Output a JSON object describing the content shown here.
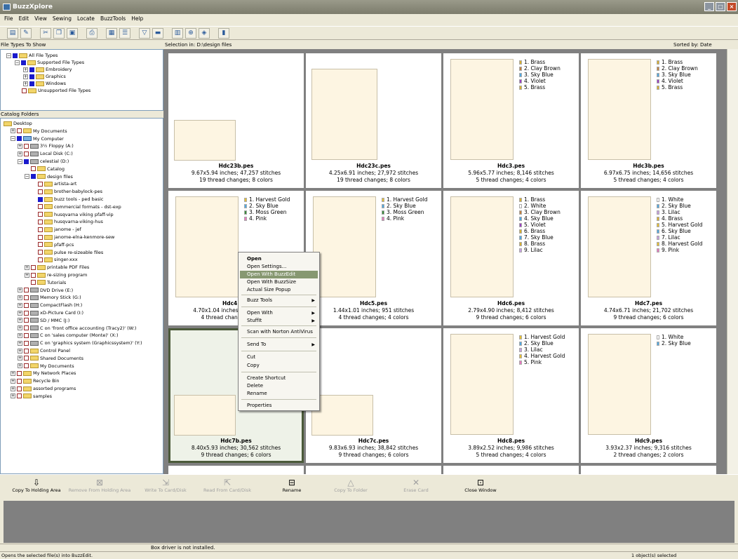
{
  "app": {
    "title": "BuzzXplore"
  },
  "menu": [
    "File",
    "Edit",
    "View",
    "Sewing",
    "Locate",
    "BuzzTools",
    "Help"
  ],
  "panels": {
    "file_types_label": "File Types To Show",
    "catalog_folders_label": "Catalog Folders",
    "selection_in": "Selection in: D:\\design files",
    "sorted_by": "Sorted by: Date"
  },
  "file_types": [
    "All File Types",
    "Supported File Types",
    "Embroidery",
    "Graphics",
    "Windows",
    "Unsupported File Types"
  ],
  "folders": [
    "Desktop",
    "My Documents",
    "My Computer",
    "3½ Floppy (A:)",
    "Local Disk (C:)",
    "celestial (D:)",
    "Catalog",
    "design files",
    "artista-art",
    "brother-babylock-pes",
    "buzz tools - ped basic",
    "commercial formats - dst-exp",
    "husqvarna viking pfaff-vip",
    "husqvarna-viking-hus",
    "janome - jef",
    "janome-elna-kenmore-sew",
    "pfaff-pcs",
    "pulse re-sizeable files",
    "singer-xxx",
    "printable PDF Files",
    "re-sizing program",
    "Tutorials",
    "DVD Drive (E:)",
    "Memory Stick (G:)",
    "CompactFlash (H:)",
    "xD-Picture Card (I:)",
    "SD / MMC (J:)",
    "C on 'front office accounting (Tracy2)' (W:)",
    "C on 'sales computer (Monte)' (X:)",
    "C on 'graphics system (Graphicssystem)' (Y:)",
    "Control Panel",
    "Shared Documents",
    "My Documents",
    "My Network Places",
    "Recycle Bin",
    "assorted programs",
    "samples"
  ],
  "cards": [
    {
      "name": "Hdc23b.pes",
      "dims": "9.67x5.94 inches; 47,257 stitches",
      "tc": "19 thread changes; 8 colors",
      "legend": []
    },
    {
      "name": "Hdc23c.pes",
      "dims": "4.25x6.91 inches; 27,972 stitches",
      "tc": "19 thread changes; 8 colors",
      "legend": []
    },
    {
      "name": "Hdc3.pes",
      "dims": "5.96x5.77 inches; 8,146 stitches",
      "tc": "5 thread changes; 4 colors",
      "legend": [
        "1.  Brass",
        "2.  Clay Brown",
        "3.  Sky Blue",
        "4.  Violet",
        "5.  Brass"
      ],
      "colors": [
        "#d8b030",
        "#c08040",
        "#50a8e0",
        "#9a40c0",
        "#d8b030"
      ]
    },
    {
      "name": "Hdc3b.pes",
      "dims": "6.97x6.75 inches; 14,656 stitches",
      "tc": "5 thread changes; 4 colors",
      "legend": [
        "1.  Brass",
        "2.  Clay Brown",
        "3.  Sky Blue",
        "4.  Violet",
        "5.  Brass"
      ],
      "colors": [
        "#d8b030",
        "#c08040",
        "#50a8e0",
        "#9a40c0",
        "#d8b030"
      ]
    },
    {
      "name": "Hdc4.pes",
      "dims": "4.70x1.04 inches; 8,071 stitches",
      "tc": "4 thread changes; 4 colors",
      "legend": [
        "1.  Harvest Gold",
        "2.  Sky Blue",
        "3.  Moss Green",
        "4.  Pink"
      ],
      "colors": [
        "#e8c030",
        "#50a8e0",
        "#3a8a3a",
        "#e878c0"
      ]
    },
    {
      "name": "Hdc5.pes",
      "dims": "1.44x1.01 inches; 951 stitches",
      "tc": "4 thread changes; 4 colors",
      "legend": [
        "1.  Harvest Gold",
        "2.  Sky Blue",
        "3.  Moss Green",
        "4.  Pink"
      ],
      "colors": [
        "#e8c030",
        "#50a8e0",
        "#3a8a3a",
        "#e878c0"
      ]
    },
    {
      "name": "Hdc6.pes",
      "dims": "2.79x4.90 inches; 8,412 stitches",
      "tc": "9 thread changes; 6 colors",
      "legend": [
        "1.  Brass",
        "2.  White",
        "3.  Clay Brown",
        "4.  Sky Blue",
        "5.  Violet",
        "6.  Brass",
        "7.  Sky Blue",
        "8.  Brass",
        "9.  Lilac"
      ],
      "colors": [
        "#d8b030",
        "#ffffff",
        "#c08040",
        "#50a8e0",
        "#9a40c0",
        "#d8b030",
        "#50a8e0",
        "#d8b030",
        "#c8a0e0"
      ]
    },
    {
      "name": "Hdc7.pes",
      "dims": "4.74x6.71 inches; 21,702 stitches",
      "tc": "9 thread changes; 6 colors",
      "legend": [
        "1.  White",
        "2.  Sky Blue",
        "3.  Lilac",
        "4.  Brass",
        "5.  Harvest Gold",
        "6.  Sky Blue",
        "7.  Lilac",
        "8.  Harvest Gold",
        "9.  Pink"
      ],
      "colors": [
        "#ffffff",
        "#50a8e0",
        "#c8a0e0",
        "#d8b030",
        "#e8c030",
        "#50a8e0",
        "#c8a0e0",
        "#e8c030",
        "#e878c0"
      ]
    },
    {
      "name": "Hdc7b.pes",
      "dims": "8.40x5.93 inches; 30,562 stitches",
      "tc": "9 thread changes; 6 colors",
      "legend": []
    },
    {
      "name": "Hdc7c.pes",
      "dims": "9.83x6.93 inches; 38,842 stitches",
      "tc": "9 thread changes; 6 colors",
      "legend": []
    },
    {
      "name": "Hdc8.pes",
      "dims": "3.89x2.52 inches; 9,986 stitches",
      "tc": "5 thread changes; 4 colors",
      "legend": [
        "1.  Harvest Gold",
        "2.  Sky Blue",
        "3.  Lilac",
        "4.  Harvest Gold",
        "5.  Pink"
      ],
      "colors": [
        "#e8c030",
        "#50a8e0",
        "#c8a0e0",
        "#e8c030",
        "#e878c0"
      ]
    },
    {
      "name": "Hdc9.pes",
      "dims": "3.93x2.37 inches; 9,316 stitches",
      "tc": "2 thread changes; 2 colors",
      "legend": [
        "1.  White",
        "2.  Sky Blue"
      ],
      "colors": [
        "#ffffff",
        "#50a8e0"
      ]
    }
  ],
  "context_menu": [
    "Open",
    "Open Settings...",
    "Open With BuzzEdit",
    "Open With BuzzSize",
    "Actual Size Popup",
    "Buzz Tools",
    "Open With",
    "StuffIt",
    "Scan with Norton AntiVirus",
    "Send To",
    "Cut",
    "Copy",
    "Create Shortcut",
    "Delete",
    "Rename",
    "Properties"
  ],
  "bottom_buttons": [
    "Copy To Holding Area",
    "Remove From Holding Area",
    "Write To Card/Disk",
    "Read From Card/Disk",
    "Rename",
    "Copy To Folder",
    "Erase Card",
    "Close Window"
  ],
  "box_driver": "Box driver is not installed.",
  "status": {
    "left": "Opens the selected file(s) into BuzzEdit.",
    "right": "1 object(s) selected"
  }
}
